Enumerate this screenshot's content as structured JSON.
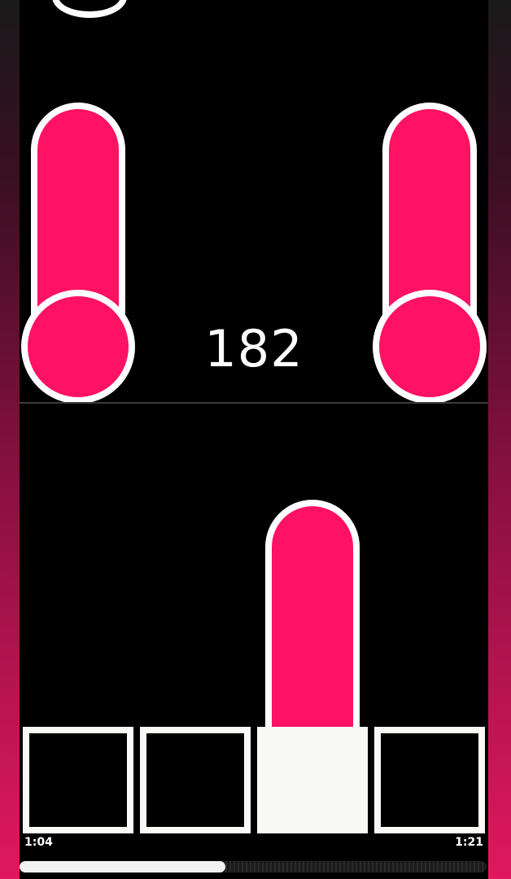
{
  "game": {
    "score": "182",
    "accent_color": "#ff1164",
    "lanes": [
      {
        "active": false
      },
      {
        "active": false
      },
      {
        "active": true
      },
      {
        "active": false
      }
    ]
  },
  "playback": {
    "elapsed": "1:04",
    "total": "1:21",
    "progress": 0.44
  }
}
